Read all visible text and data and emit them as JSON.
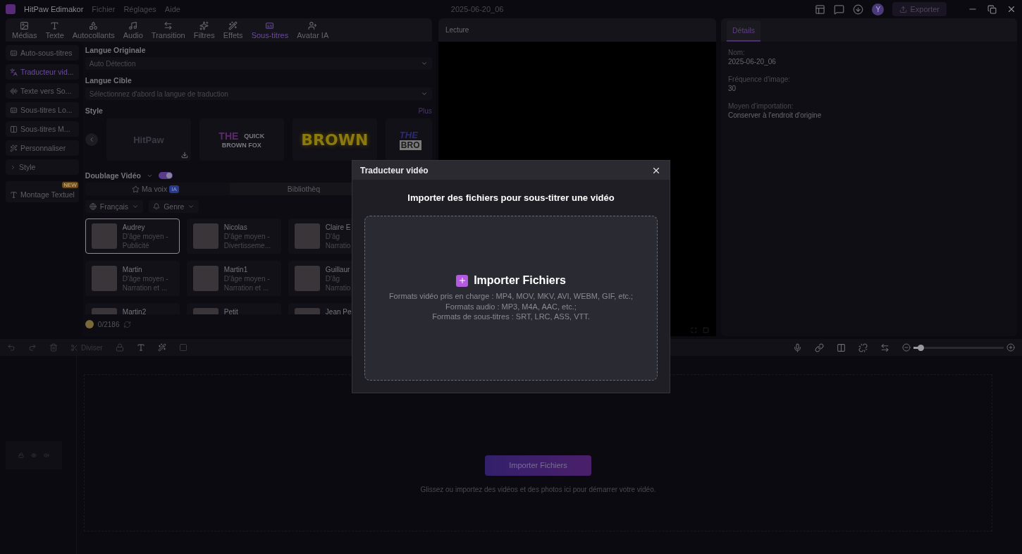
{
  "titlebar": {
    "app_name": "HitPaw Edimakor",
    "menus": [
      "Fichier",
      "Réglages",
      "Aide"
    ],
    "project": "2025-06-20_06",
    "avatar": "Y",
    "export": "Exporter"
  },
  "tabs": [
    {
      "label": "Médias",
      "selected": false
    },
    {
      "label": "Texte",
      "selected": false
    },
    {
      "label": "Autocollants",
      "selected": false
    },
    {
      "label": "Audio",
      "selected": false
    },
    {
      "label": "Transition",
      "selected": false
    },
    {
      "label": "Filtres",
      "selected": false
    },
    {
      "label": "Effets",
      "selected": false
    },
    {
      "label": "Sous-titres",
      "selected": true
    },
    {
      "label": "Avatar IA",
      "selected": false
    }
  ],
  "sidebar": [
    {
      "label": "Auto-sous-titres",
      "kind": "item",
      "selected": false
    },
    {
      "label": "Traducteur vid...",
      "kind": "item",
      "selected": true
    },
    {
      "label": "Texte vers So...",
      "kind": "item",
      "selected": false
    },
    {
      "label": "Sous-titres Lo...",
      "kind": "item",
      "selected": false
    },
    {
      "label": "Sous-titres M...",
      "kind": "item",
      "selected": false
    },
    {
      "label": "Personnaliser",
      "kind": "item",
      "selected": false
    },
    {
      "label": "Style",
      "kind": "group",
      "selected": false
    },
    {
      "label": "Montage Textuel",
      "kind": "item",
      "selected": false,
      "badge": "NEW"
    }
  ],
  "source_language": {
    "label": "Langue Originale",
    "value": "Auto Détection"
  },
  "target_language": {
    "label": "Langue Cible",
    "placeholder": "Sélectionnez d'abord la langue de traduction"
  },
  "style": {
    "label": "Style",
    "more": "Plus",
    "presets": [
      {
        "kind": "plain",
        "text": "HitPaw"
      },
      {
        "kind": "quick",
        "text": "THE",
        "text2": "QUICK",
        "text3": "BROWN FOX"
      },
      {
        "kind": "glow",
        "text": "BROWN"
      },
      {
        "kind": "comic",
        "text": "THE",
        "text2": "BRO"
      }
    ]
  },
  "dubbing": {
    "label": "Doublage Vidéo",
    "on": true,
    "tabs": [
      {
        "label": "Ma voix",
        "badge": "IA",
        "selected": true
      },
      {
        "label": "Bibliothèq",
        "selected": false
      }
    ],
    "filters": [
      "Français",
      "Genre"
    ],
    "voices": [
      {
        "name": "Audrey",
        "line1": "D'âge moyen -",
        "line2": "Publicité",
        "selected": true
      },
      {
        "name": "Nicolas",
        "line1": "D'âge moyen -",
        "line2": "Divertisseme...",
        "selected": false
      },
      {
        "name": "Claire E",
        "line1": "D'âg",
        "line2": "Narratio",
        "selected": false
      },
      {
        "name": "Martin",
        "line1": "D'âge moyen -",
        "line2": "Narration et ...",
        "selected": false
      },
      {
        "name": "Martin1",
        "line1": "D'âge moyen -",
        "line2": "Narration et ...",
        "selected": false
      },
      {
        "name": "Guillaur",
        "line1": "D'âg",
        "line2": "Narratio",
        "selected": false
      },
      {
        "name": "Martin2",
        "selected": false
      },
      {
        "name": "Petit",
        "selected": false
      },
      {
        "name": "Jean Pe",
        "selected": false
      }
    ],
    "credits": "0/2186"
  },
  "player": {
    "title": "Lecture"
  },
  "details": {
    "tab": "Détails",
    "fields": [
      {
        "label": "Nom:",
        "value": "2025-06-20_06"
      },
      {
        "label": "Fréquence d'image:",
        "value": "30"
      },
      {
        "label": "Moyen d'importation:",
        "value": "Conserver à l'endroit d'origine"
      }
    ]
  },
  "timeline": {
    "split": "Diviser",
    "zoom": {
      "level": 0.08
    },
    "import_button": "Importer Fichiers",
    "hint": "Glissez ou importez des vidéos et des photos ici pour démarrer votre vidéo."
  },
  "dialog": {
    "title": "Traducteur vidéo",
    "heading": "Importer des fichiers pour sous-titrer une vidéo",
    "import": "Importer Fichiers",
    "formats": [
      "Formats vidéo pris en charge : MP4, MOV, MKV, AVI, WEBM, GIF, etc.;",
      "Formats audio : MP3, M4A, AAC, etc.;",
      "Formats de sous-titres : SRT, LRC, ASS, VTT."
    ]
  }
}
